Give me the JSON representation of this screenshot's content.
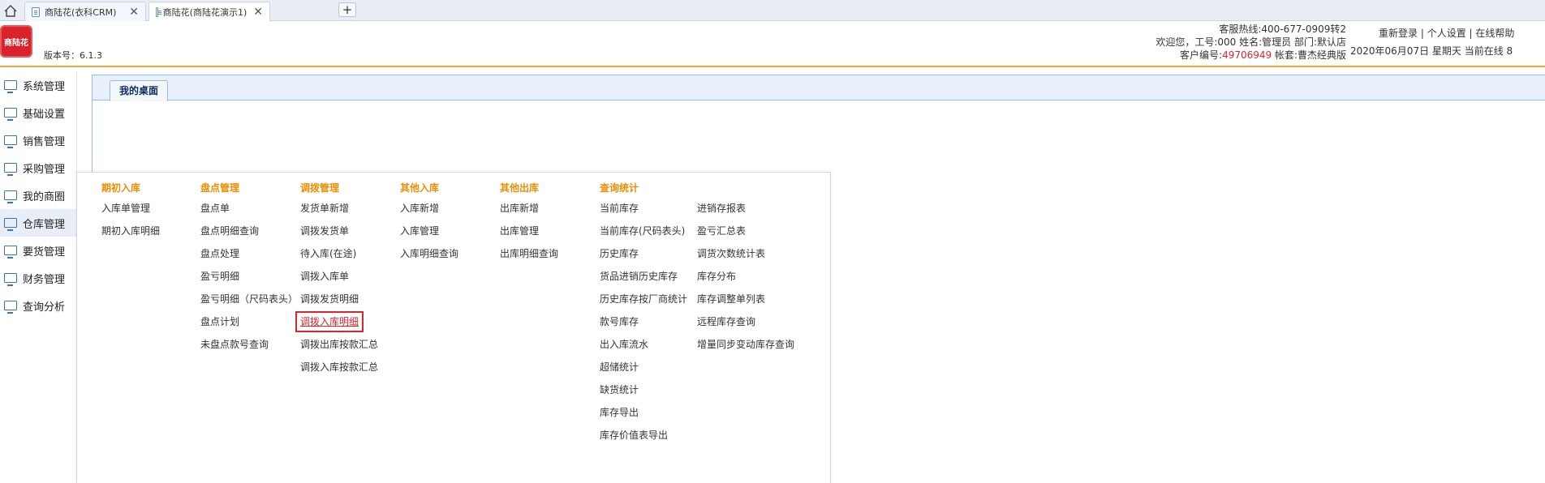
{
  "browser": {
    "tabs": [
      {
        "title": "商陆花(衣科CRM)",
        "close": "✕"
      },
      {
        "title": "商陆花(商陆花演示1)",
        "close": "✕"
      }
    ],
    "new_tab": "+"
  },
  "header": {
    "logo_text": "商陆花",
    "version": "版本号：6.1.3",
    "hotline": "客服热线:400-677-0909转2",
    "welcome": "欢迎您，工号:000 姓名:管理员 部门:默认店",
    "customer_label": "客户编号:",
    "customer_no": "49706949",
    "package": " 帐套:曹杰经典版",
    "links": {
      "relogin": "重新登录",
      "sep1": " | ",
      "settings": "个人设置",
      "sep2": " | ",
      "help": "在线帮助"
    },
    "date": "2020年06月07日 星期天 当前在线 8",
    "accent_color": "#f4a33b"
  },
  "sidebar": {
    "items": [
      {
        "label": "系统管理"
      },
      {
        "label": "基础设置"
      },
      {
        "label": "销售管理"
      },
      {
        "label": "采购管理"
      },
      {
        "label": "我的商圈"
      },
      {
        "label": "仓库管理"
      },
      {
        "label": "要货管理"
      },
      {
        "label": "财务管理"
      },
      {
        "label": "查询分析"
      }
    ]
  },
  "main": {
    "tab": "我的桌面"
  },
  "menu": {
    "columns": [
      {
        "title": "期初入库",
        "items": [
          "入库单管理",
          "期初入库明细"
        ]
      },
      {
        "title": "盘点管理",
        "items": [
          "盘点单",
          "盘点明细查询",
          "盘点处理",
          "盈亏明细",
          "盈亏明细（尺码表头）",
          "盘点计划",
          "未盘点款号查询"
        ]
      },
      {
        "title": "调拨管理",
        "items": [
          "发货单新增",
          "调拨发货单",
          "待入库(在途)",
          "调拨入库单",
          "调拨发货明细",
          "调拨入库明细",
          "调拨出库按款汇总",
          "调拨入库按款汇总"
        ]
      },
      {
        "title": "其他入库",
        "items": [
          "入库新增",
          "入库管理",
          "入库明细查询"
        ]
      },
      {
        "title": "其他出库",
        "items": [
          "出库新增",
          "出库管理",
          "出库明细查询"
        ]
      },
      {
        "title": "查询统计",
        "items": [
          "当前库存",
          "当前库存(尺码表头)",
          "历史库存",
          "货品进销历史库存",
          "历史库存按厂商统计",
          "款号库存",
          "出入库流水",
          "超储统计",
          "缺货统计",
          "库存导出",
          "库存价值表导出"
        ]
      },
      {
        "title": "",
        "items": [
          "进销存报表",
          "盈亏汇总表",
          "调货次数统计表",
          "库存分布",
          "库存调整单列表",
          "远程库存查询",
          "增量同步变动库存查询"
        ]
      }
    ],
    "highlighted": "调拨入库明细",
    "title_color": "#f28c00",
    "highlight_color": "#e0242b"
  }
}
